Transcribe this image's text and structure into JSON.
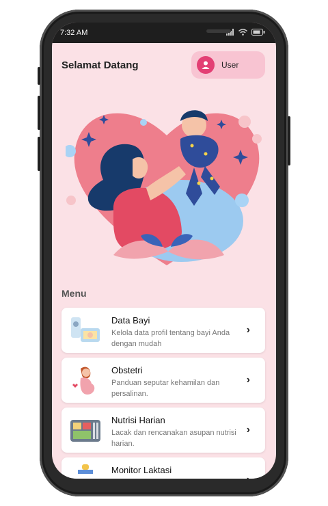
{
  "status_bar": {
    "time": "7:32 AM"
  },
  "header": {
    "welcome": "Selamat Datang",
    "user_label": "User"
  },
  "menu": {
    "title": "Menu",
    "items": [
      {
        "title": "Data Bayi",
        "description": "Kelola data profil tentang bayi Anda dengan mudah",
        "icon": "baby-monitor-icon"
      },
      {
        "title": "Obstetri",
        "description": "Panduan seputar kehamilan dan persalinan.",
        "icon": "pregnant-woman-icon"
      },
      {
        "title": "Nutrisi Harian",
        "description": "Lacak dan rencanakan asupan nutrisi harian.",
        "icon": "food-tray-icon"
      },
      {
        "title": "Monitor Laktasi",
        "description": "",
        "icon": "baby-bottle-icon"
      }
    ]
  },
  "colors": {
    "background": "#fbe1e6",
    "accent": "#e33f74",
    "pill": "#f8c4d2"
  }
}
